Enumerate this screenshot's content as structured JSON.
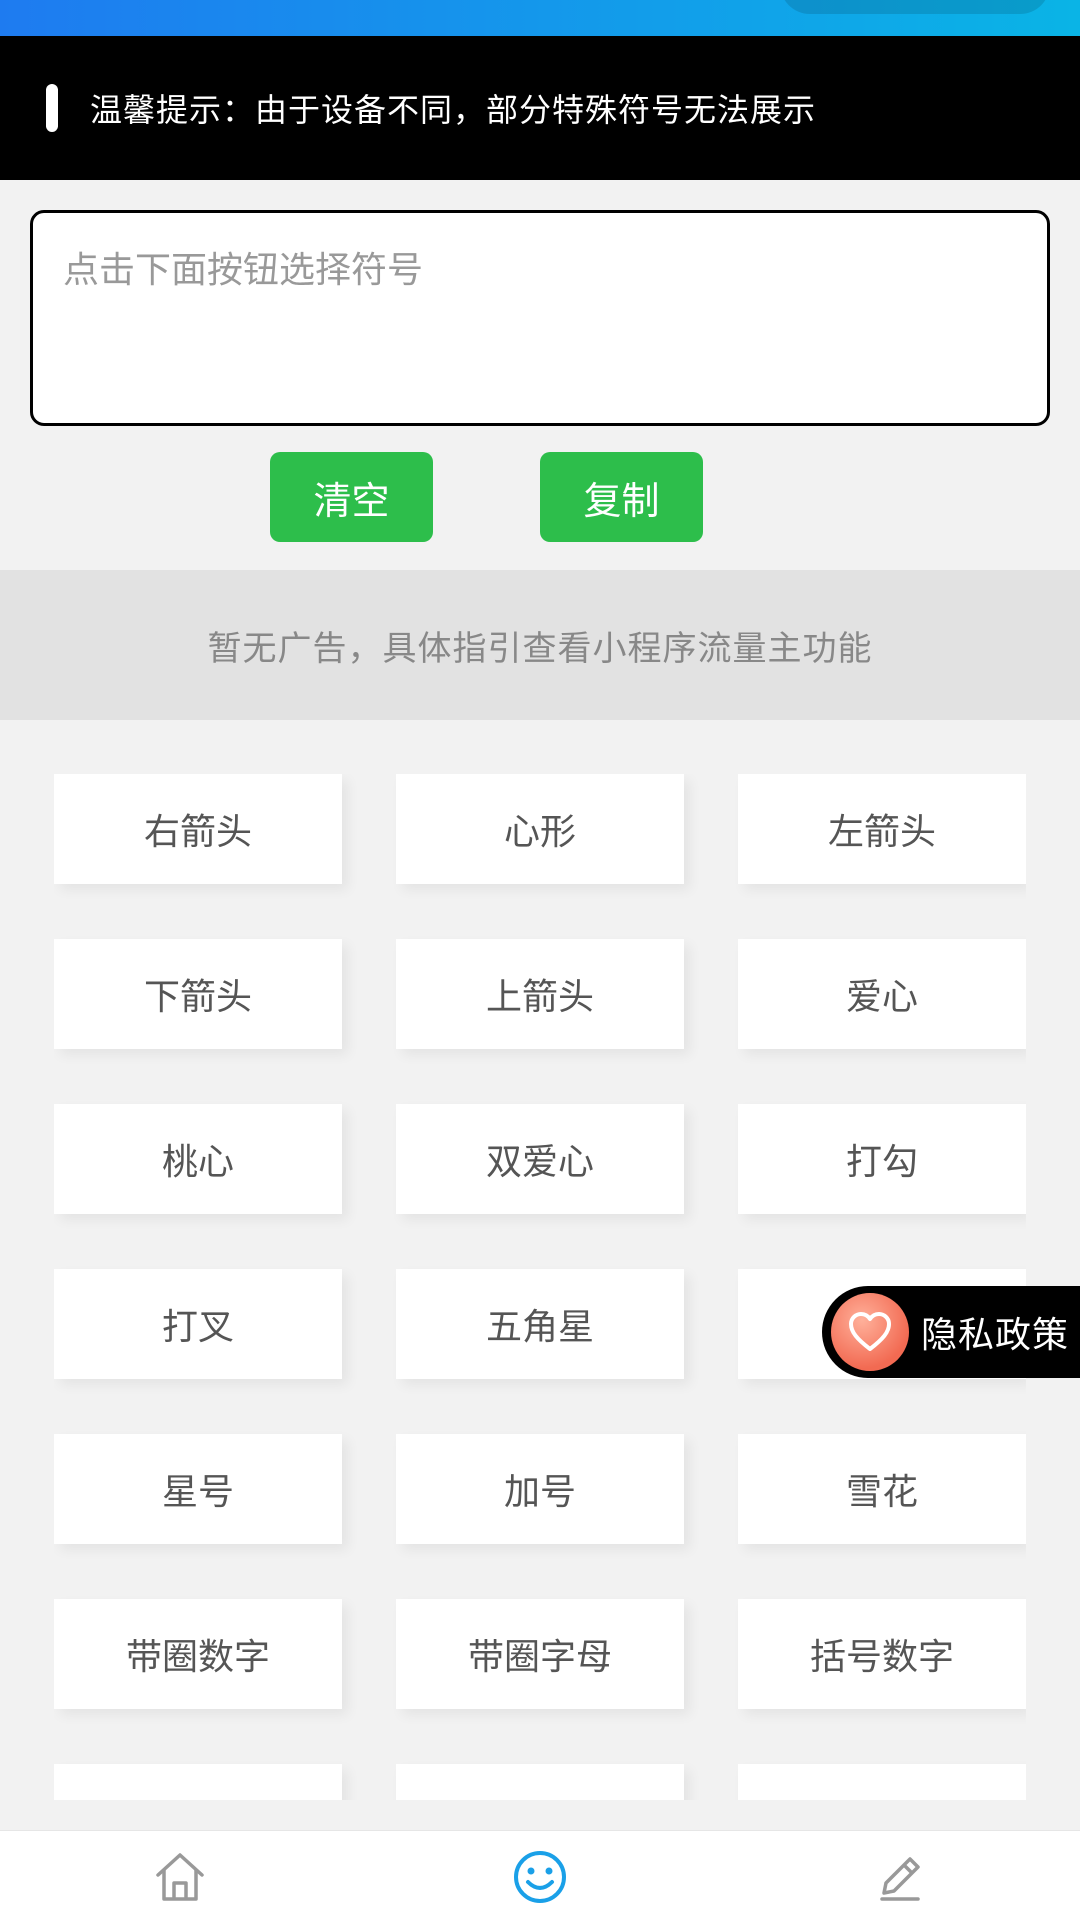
{
  "notice": {
    "text": "温馨提示：由于设备不同，部分特殊符号无法展示"
  },
  "input": {
    "placeholder": "点击下面按钮选择符号"
  },
  "buttons": {
    "clear": "清空",
    "copy": "复制"
  },
  "ad": {
    "text": "暂无广告，具体指引查看小程序流量主功能"
  },
  "symbols": [
    "右箭头",
    "心形",
    "左箭头",
    "下箭头",
    "上箭头",
    "爱心",
    "桃心",
    "双爱心",
    "打勾",
    "打叉",
    "五角星",
    "",
    "星号",
    "加号",
    "雪花",
    "带圈数字",
    "带圈字母",
    "括号数字",
    "",
    "",
    ""
  ],
  "privacy": {
    "label": "隐私政策",
    "icon": "heart-icon"
  },
  "tabbar": {
    "items": [
      {
        "icon": "home-icon"
      },
      {
        "icon": "smile-icon",
        "active": true
      },
      {
        "icon": "pencil-icon"
      }
    ]
  },
  "colors": {
    "green": "#2dbe4b",
    "active_tab": "#1aa0e8",
    "inactive_tab": "#999999"
  }
}
